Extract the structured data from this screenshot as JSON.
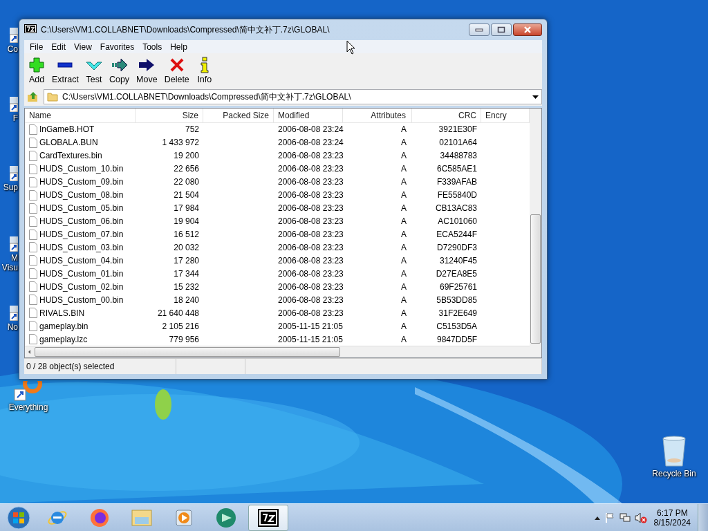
{
  "desktop_icons": [
    {
      "label": "Co"
    },
    {
      "label": "F"
    },
    {
      "label": "Sup"
    },
    {
      "label": "M Visu"
    },
    {
      "label": "No"
    },
    {
      "label": "Everything"
    },
    {
      "label": "Recycle Bin"
    }
  ],
  "window": {
    "title": "C:\\Users\\VM1.COLLABNET\\Downloads\\Compressed\\简中文补丁.7z\\GLOBAL\\"
  },
  "menu": [
    "File",
    "Edit",
    "View",
    "Favorites",
    "Tools",
    "Help"
  ],
  "toolbar": [
    {
      "kind": "add",
      "label": "Add"
    },
    {
      "kind": "extract",
      "label": "Extract"
    },
    {
      "kind": "test",
      "label": "Test"
    },
    {
      "kind": "copy",
      "label": "Copy"
    },
    {
      "kind": "move",
      "label": "Move"
    },
    {
      "kind": "delete",
      "label": "Delete"
    },
    {
      "kind": "info",
      "label": "Info"
    }
  ],
  "address": "C:\\Users\\VM1.COLLABNET\\Downloads\\Compressed\\简中文补丁.7z\\GLOBAL\\",
  "table": {
    "columns": [
      "Name",
      "Size",
      "Packed Size",
      "Modified",
      "Attributes",
      "CRC",
      "Encry"
    ],
    "rows": [
      {
        "name": "InGameB.HOT",
        "size": "752",
        "modified": "2006-08-08 23:24",
        "attributes": "A",
        "crc": "3921E30F"
      },
      {
        "name": "GLOBALA.BUN",
        "size": "1 433 972",
        "modified": "2006-08-08 23:24",
        "attributes": "A",
        "crc": "02101A64"
      },
      {
        "name": "CardTextures.bin",
        "size": "19 200",
        "modified": "2006-08-08 23:23",
        "attributes": "A",
        "crc": "34488783"
      },
      {
        "name": "HUDS_Custom_10.bin",
        "size": "22 656",
        "modified": "2006-08-08 23:23",
        "attributes": "A",
        "crc": "6C585AE1"
      },
      {
        "name": "HUDS_Custom_09.bin",
        "size": "22 080",
        "modified": "2006-08-08 23:23",
        "attributes": "A",
        "crc": "F339AFAB"
      },
      {
        "name": "HUDS_Custom_08.bin",
        "size": "21 504",
        "modified": "2006-08-08 23:23",
        "attributes": "A",
        "crc": "FE55840D"
      },
      {
        "name": "HUDS_Custom_05.bin",
        "size": "17 984",
        "modified": "2006-08-08 23:23",
        "attributes": "A",
        "crc": "CB13AC83"
      },
      {
        "name": "HUDS_Custom_06.bin",
        "size": "19 904",
        "modified": "2006-08-08 23:23",
        "attributes": "A",
        "crc": "AC101060"
      },
      {
        "name": "HUDS_Custom_07.bin",
        "size": "16 512",
        "modified": "2006-08-08 23:23",
        "attributes": "A",
        "crc": "ECA5244F"
      },
      {
        "name": "HUDS_Custom_03.bin",
        "size": "20 032",
        "modified": "2006-08-08 23:23",
        "attributes": "A",
        "crc": "D7290DF3"
      },
      {
        "name": "HUDS_Custom_04.bin",
        "size": "17 280",
        "modified": "2006-08-08 23:23",
        "attributes": "A",
        "crc": "31240F45"
      },
      {
        "name": "HUDS_Custom_01.bin",
        "size": "17 344",
        "modified": "2006-08-08 23:23",
        "attributes": "A",
        "crc": "D27EA8E5"
      },
      {
        "name": "HUDS_Custom_02.bin",
        "size": "15 232",
        "modified": "2006-08-08 23:23",
        "attributes": "A",
        "crc": "69F25761"
      },
      {
        "name": "HUDS_Custom_00.bin",
        "size": "18 240",
        "modified": "2006-08-08 23:23",
        "attributes": "A",
        "crc": "5B53DD85"
      },
      {
        "name": "RIVALS.BIN",
        "size": "21 640 448",
        "modified": "2006-08-08 23:23",
        "attributes": "A",
        "crc": "31F2E649"
      },
      {
        "name": "gameplay.bin",
        "size": "2 105 216",
        "modified": "2005-11-15 21:05",
        "attributes": "A",
        "crc": "C5153D5A"
      },
      {
        "name": "gameplay.lzc",
        "size": "779 956",
        "modified": "2005-11-15 21:05",
        "attributes": "A",
        "crc": "9847DD5F"
      }
    ]
  },
  "status_bar": "0 / 28 object(s) selected",
  "taskbar": {
    "items": [
      {
        "kind": "ie",
        "selected": false
      },
      {
        "kind": "firefox",
        "selected": false
      },
      {
        "kind": "explorer",
        "selected": false
      },
      {
        "kind": "media",
        "selected": false
      },
      {
        "kind": "app",
        "selected": false
      },
      {
        "kind": "sevenzip",
        "selected": true
      }
    ],
    "clock": {
      "time": "6:17 PM",
      "date": "8/15/2024"
    }
  }
}
